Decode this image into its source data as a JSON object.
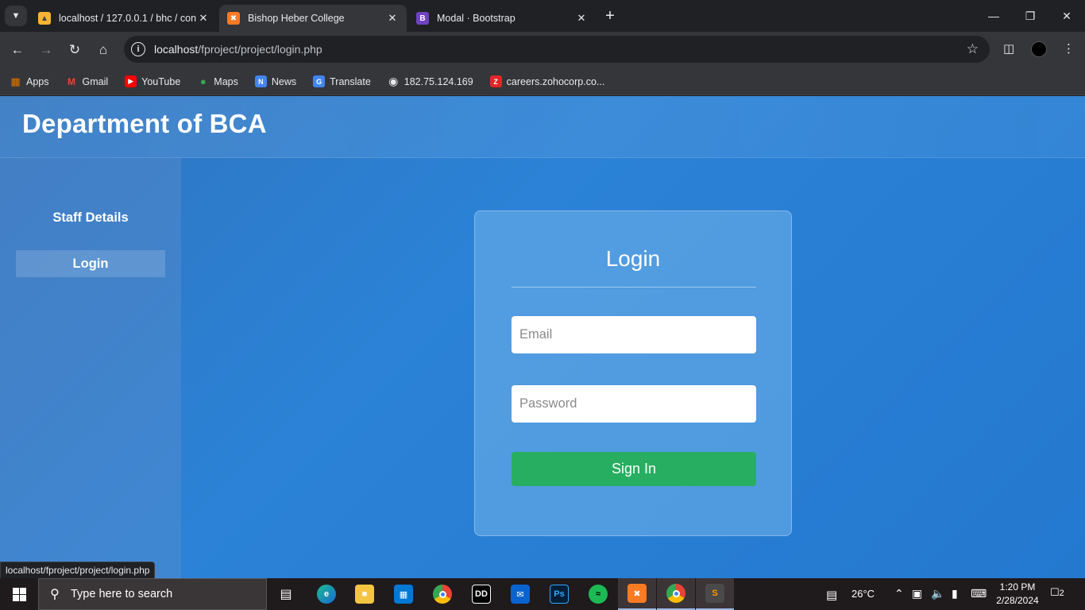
{
  "browser": {
    "tabs": [
      {
        "title": "localhost / 127.0.0.1 / bhc / con",
        "favicon": "phpmyadmin-icon",
        "active": false
      },
      {
        "title": "Bishop Heber College",
        "favicon": "xampp-icon",
        "active": true
      },
      {
        "title": "Modal · Bootstrap",
        "favicon": "bootstrap-icon",
        "active": false
      }
    ],
    "url_host": "localhost",
    "url_path": "/fproject/project/login.php",
    "bookmarks": [
      {
        "label": "Apps",
        "icon": "apps-grid-icon"
      },
      {
        "label": "Gmail",
        "icon": "gmail-icon"
      },
      {
        "label": "YouTube",
        "icon": "youtube-icon"
      },
      {
        "label": "Maps",
        "icon": "maps-icon"
      },
      {
        "label": "News",
        "icon": "news-icon"
      },
      {
        "label": "Translate",
        "icon": "translate-icon"
      },
      {
        "label": "182.75.124.169",
        "icon": "globe-icon"
      },
      {
        "label": "careers.zohocorp.co...",
        "icon": "zoho-icon"
      }
    ],
    "status_url": "localhost/fproject/project/login.php"
  },
  "page": {
    "site_title": "Department of BCA",
    "sidebar": [
      {
        "label": "Staff Details",
        "active": false
      },
      {
        "label": "Login",
        "active": true
      }
    ],
    "login": {
      "title": "Login",
      "email_placeholder": "Email",
      "password_placeholder": "Password",
      "submit_label": "Sign In"
    }
  },
  "taskbar": {
    "search_placeholder": "Type here to search",
    "apps": [
      "task-view-icon",
      "edge-icon",
      "file-explorer-icon",
      "store-icon",
      "chrome-icon",
      "dolby-icon",
      "mail-icon",
      "photoshop-icon",
      "spotify-icon",
      "xampp-icon",
      "chrome-profile-icon",
      "sublime-icon"
    ],
    "weather": "26°C",
    "time": "1:20 PM",
    "date": "2/28/2024",
    "notification_count": "2"
  },
  "colors": {
    "page_bg": "#2b82d6",
    "signin_button": "#27ae60",
    "browser_chrome": "#35363a"
  }
}
